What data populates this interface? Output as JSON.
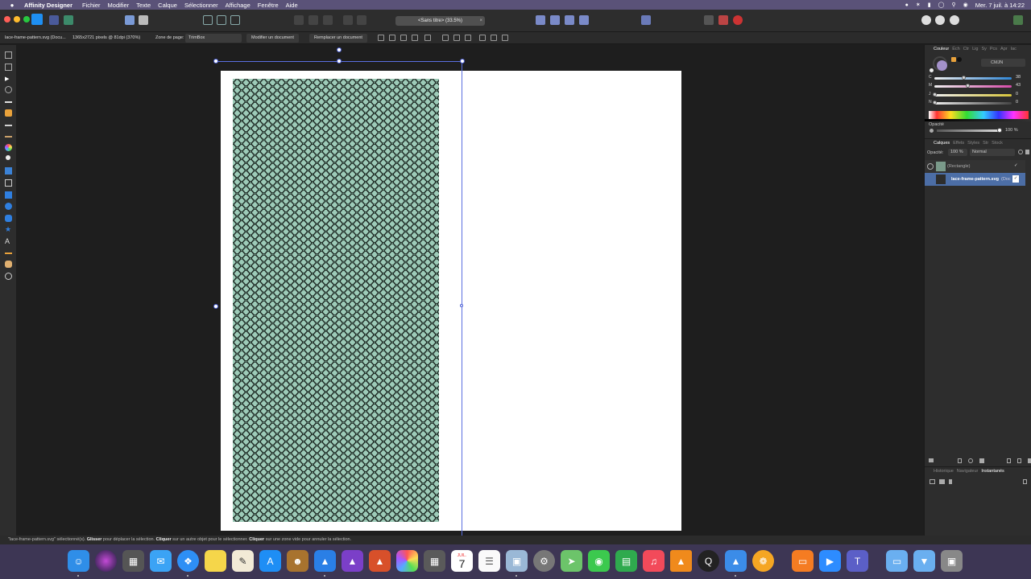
{
  "menubar": {
    "app_name": "Affinity Designer",
    "items": [
      "Fichier",
      "Modifier",
      "Texte",
      "Calque",
      "Sélectionner",
      "Affichage",
      "Fenêtre",
      "Aide"
    ],
    "datetime": "Mer. 7 juil. à  14:22"
  },
  "toolbar": {
    "document_title": "<Sans titre> (33.5%)",
    "close_glyph": "×"
  },
  "context": {
    "filename": "lace-frame-pattern.svg (Docu...",
    "dimensions": "1365x2721 pixels @ 81dpi (370%)",
    "page_box_label": "Zone de page:",
    "page_box_value": "TrimBox",
    "edit_document": "Modifier un document",
    "replace_document": "Remplacer un document"
  },
  "colour_panel": {
    "tabs": [
      "Couleur",
      "Éch",
      "Ctr",
      "Lig",
      "Sy",
      "Pcs",
      "Apr",
      "Iac"
    ],
    "model": "CMJN",
    "channels": [
      {
        "label": "C",
        "value": "38",
        "fraction": 0.38,
        "color": "#2f86d6"
      },
      {
        "label": "M",
        "value": "43",
        "fraction": 0.43,
        "color": "#d44aa8"
      },
      {
        "label": "J",
        "value": "0",
        "fraction": 0.0,
        "color": "#d6c43a"
      },
      {
        "label": "N",
        "value": "0",
        "fraction": 0.0,
        "color": "#444444"
      }
    ],
    "opacity_label": "Opacité",
    "opacity_value": "100 %"
  },
  "layers_panel": {
    "tabs": [
      "Calques",
      "Effets",
      "Styles",
      "Str",
      "Stock"
    ],
    "opacity_label": "Opacité:",
    "opacity_value": "100 %",
    "blend_mode": "Normal",
    "layers": [
      {
        "name": "(Rectangle)",
        "selected": false
      },
      {
        "name": "lace-frame-pattern.svg",
        "suffix": "(Doc",
        "selected": true
      }
    ]
  },
  "history_panel": {
    "tabs": [
      "Historique",
      "Navigateur",
      "Instantanés"
    ]
  },
  "status": {
    "part1": "\"lace-frame-pattern.svg\" sélectionné(s). ",
    "b1": "Glisser",
    "part2": " pour déplacer la sélection. ",
    "b2": "Cliquer",
    "part3": " sur un autre objet pour le sélectionner. ",
    "b3": "Cliquer",
    "part4": " sur une zone vide pour annuler la sélection."
  },
  "dock": {
    "calendar_month": "JUIL.",
    "calendar_day": "7"
  },
  "colors": {
    "pattern_fill": "#9dcbb8",
    "selection": "#5a6fe0",
    "menubar": "#5a5278"
  }
}
